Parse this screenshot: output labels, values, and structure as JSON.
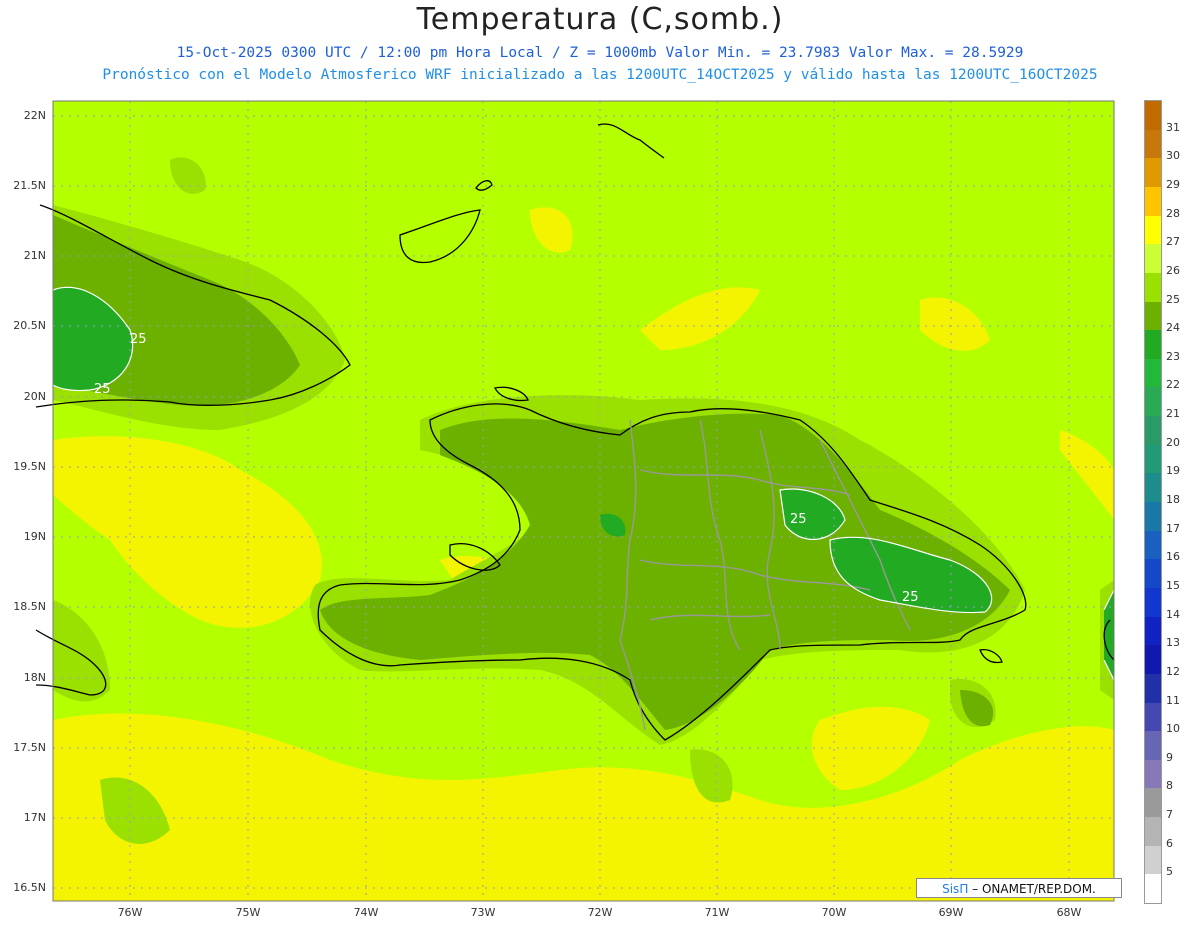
{
  "header": {
    "title": "Temperatura (C,somb.)",
    "line1": "15-Oct-2025 0300 UTC / 12:00 pm Hora Local / Z = 1000mb  Valor Min. = 23.7983  Valor Max. = 28.5929",
    "line2": "Pronóstico con el Modelo Atmosferico WRF inicializado a las 1200UTC_14OCT2025 y válido hasta las  1200UTC_16OCT2025"
  },
  "axes": {
    "lat_labels": [
      "22N",
      "21.5N",
      "21N",
      "20.5N",
      "20N",
      "19.5N",
      "19N",
      "18.5N",
      "18N",
      "17.5N",
      "17N",
      "16.5N"
    ],
    "lon_labels": [
      "76W",
      "75W",
      "74W",
      "73W",
      "72W",
      "71W",
      "70W",
      "69W",
      "68W"
    ]
  },
  "contour_labels": [
    "25",
    "25",
    "25",
    "25"
  ],
  "credit": {
    "brand": "SisΠ",
    "text": " – ONAMET/REP.DOM."
  },
  "colorbar": {
    "labels": [
      "31",
      "30",
      "29",
      "28",
      "27",
      "26",
      "25",
      "24",
      "23",
      "22",
      "21",
      "20",
      "19",
      "18",
      "17",
      "16",
      "15",
      "14",
      "13",
      "12",
      "11",
      "10",
      "9",
      "8",
      "7",
      "6",
      "5"
    ],
    "colors": [
      "#c8780a",
      "#e09a00",
      "#ffc400",
      "#ffff00",
      "#ccff33",
      "#9ae000",
      "#6cb000",
      "#22aa22",
      "#22b83a",
      "#2aaa55",
      "#2a9a66",
      "#229977",
      "#1c8c8c",
      "#1a78a8",
      "#1a60c0",
      "#1448c8",
      "#1236d0",
      "#1022c4",
      "#1018b0",
      "#2030a8",
      "#4448b0",
      "#6666b4",
      "#8878b8",
      "#9a9a9a",
      "#b4b4b4",
      "#d0d0d0",
      "#ffffff"
    ]
  },
  "colors": {
    "background_field": "#b4ff00",
    "warm_field": "#f4f400",
    "mid_field": "#8fcf30",
    "cool_field": "#6aa824",
    "coolest_field": "#22aa22"
  }
}
